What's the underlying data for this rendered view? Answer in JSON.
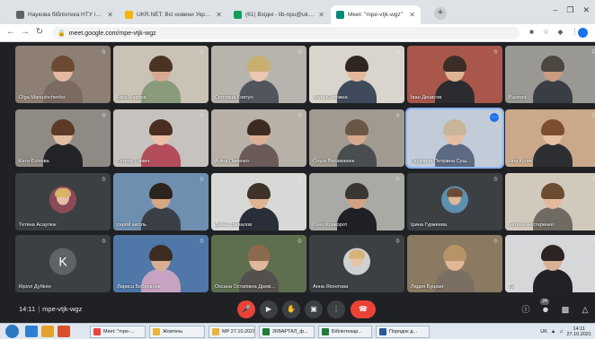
{
  "browser": {
    "tabs": [
      {
        "title": "Наукова бібліотека НТУ імені І",
        "fav": "#5f6368",
        "active": false
      },
      {
        "title": "UKR.NET: Всі новини України, о",
        "fav": "#f4b400",
        "active": false
      },
      {
        "title": "(61) Вхідні - lib-npu@ukr.net",
        "fav": "#0f9d58",
        "active": false
      },
      {
        "title": "Meet: \"mpe-vtjk-wgz\"",
        "fav": "#00897b",
        "active": true
      }
    ],
    "new_tab_label": "+",
    "url": "meet.google.com/mpe-vtjk-wgz"
  },
  "participants": [
    {
      "name": "Olga Manushchenko",
      "bg": "#8d7f73",
      "skin": "#e3b9a0",
      "hair": "#6b4a34",
      "shirt": "#7a6a60"
    },
    {
      "name": "Lara Mazepa",
      "bg": "#c9c2b5",
      "skin": "#d7a98e",
      "hair": "#4a3325",
      "shirt": "#8a9a7d"
    },
    {
      "name": "Світлана Ковтун",
      "bg": "#b7b3ad",
      "skin": "#eac7b0",
      "hair": "#c8b070",
      "shirt": "#51565e"
    },
    {
      "name": "Алла Калюжна",
      "bg": "#d9d4cc",
      "skin": "#e2b79b",
      "hair": "#2f2620",
      "shirt": "#3f4a5a"
    },
    {
      "name": "Іван Денисов",
      "bg": "#a8574a",
      "skin": "#e0b493",
      "hair": "#3a2d25",
      "shirt": "#2c2c30"
    },
    {
      "name": "Валера",
      "bg": "#9a9893",
      "skin": "#c99b80",
      "hair": "#4b4640",
      "shirt": "#3a3d44"
    },
    {
      "name": "Катя Єсіпова",
      "bg": "#8f8a84",
      "skin": "#e4bda5",
      "hair": "#5b3a28",
      "shirt": "#232427"
    },
    {
      "name": "Тетяна Хомич",
      "bg": "#c6c3bf",
      "skin": "#e8c1a8",
      "hair": "#4a2e22",
      "shirt": "#b34d5c"
    },
    {
      "name": "Аліна Павенко",
      "bg": "#b8b1a8",
      "skin": "#dcaf95",
      "hair": "#3d2a20",
      "shirt": "#6a5b58"
    },
    {
      "name": "Ольга Ватаманюк",
      "bg": "#a09a90",
      "skin": "#d5a98d",
      "hair": "#6a5646",
      "shirt": "#4a4d4f"
    },
    {
      "name": "Людмила Петрівна Сущ...",
      "bg": "#c2ccd8",
      "skin": "#e4bea2",
      "hair": "#c9b59a",
      "shirt": "#5d6a83",
      "speaking": true
    },
    {
      "name": "Яна Кулик",
      "bg": "#caa98a",
      "skin": "#e6c0a2",
      "hair": "#7b4e2e",
      "shirt": "#2e2f33"
    },
    {
      "name": "Тетяна Асаулюк",
      "avatar": "photo",
      "bg": "#3c4043",
      "skin": "#e5bfa4",
      "hair": "#d8b36a",
      "shirt": "#8c4a58"
    },
    {
      "name": "сергій кисіль",
      "bg": "#6f8fb0",
      "skin": "#d7a684",
      "hair": "#2c231d",
      "shirt": "#3b3f46"
    },
    {
      "name": "Дима Привалов",
      "bg": "#d8d8d6",
      "skin": "#e1b393",
      "hair": "#3e3229",
      "shirt": "#2a2e38"
    },
    {
      "name": "Олег Криворот",
      "bg": "#a9aaa6",
      "skin": "#d2a283",
      "hair": "#3a3631",
      "shirt": "#1f2025"
    },
    {
      "name": "Ірина Гуржеева",
      "avatar": "photo",
      "bg": "#3c4043",
      "skin": "#e0b797",
      "hair": "#6b4b35",
      "shirt": "#5e8fb0"
    },
    {
      "name": "Тетяна Нестеренко",
      "bg": "#d2c9bd",
      "skin": "#e3bb9c",
      "hair": "#6d4b31",
      "shirt": "#6f6a62"
    },
    {
      "name": "Кірілл Дубінін",
      "avatar": "letter",
      "letter": "K",
      "bg": "#3c4043",
      "circle": "#5f6368"
    },
    {
      "name": "Лариса Бобровник",
      "bg": "#4f77a8",
      "skin": "#d9ae92",
      "hair": "#3d2c22",
      "shirt": "#c6a3c0"
    },
    {
      "name": "Оксана Остапівна Древі...",
      "bg": "#5d6f4f",
      "skin": "#e1b89b",
      "hair": "#8a6a4c",
      "shirt": "#54504b"
    },
    {
      "name": "Анна Яхонтова",
      "avatar": "photo",
      "bg": "#3c4043",
      "skin": "#e7c3a9",
      "hair": "#d6b27a",
      "shirt": "#d0d0d0"
    },
    {
      "name": "Лидия Буцкая",
      "bg": "#8a7a62",
      "skin": "#e0b696",
      "hair": "#b89368",
      "shirt": "#7b6f63"
    },
    {
      "name": "Ви",
      "bg": "#d6d7d9",
      "skin": "#dcb094",
      "hair": "#2c2422",
      "shirt": "#222226"
    }
  ],
  "controls": {
    "time": "14:11",
    "separator": "|",
    "meeting_code": "mpe-vtjk-wgz",
    "participants_count": "24"
  },
  "taskbar": {
    "items": [
      {
        "label": "Meet: \"mpe-...",
        "color": "#e8453c"
      },
      {
        "label": "Жовтень",
        "color": "#e8b53a"
      },
      {
        "label": "МР 27.10.2021",
        "color": "#e8b53a"
      },
      {
        "label": "2КВАРТАЛ_ф...",
        "color": "#1f7a3d"
      },
      {
        "label": "Бібліотекар...",
        "color": "#1f7a3d"
      },
      {
        "label": "Порядок д...",
        "color": "#2b5797"
      }
    ],
    "lang": "UK",
    "clock_time": "14:11",
    "clock_date": "27.10.2021"
  }
}
